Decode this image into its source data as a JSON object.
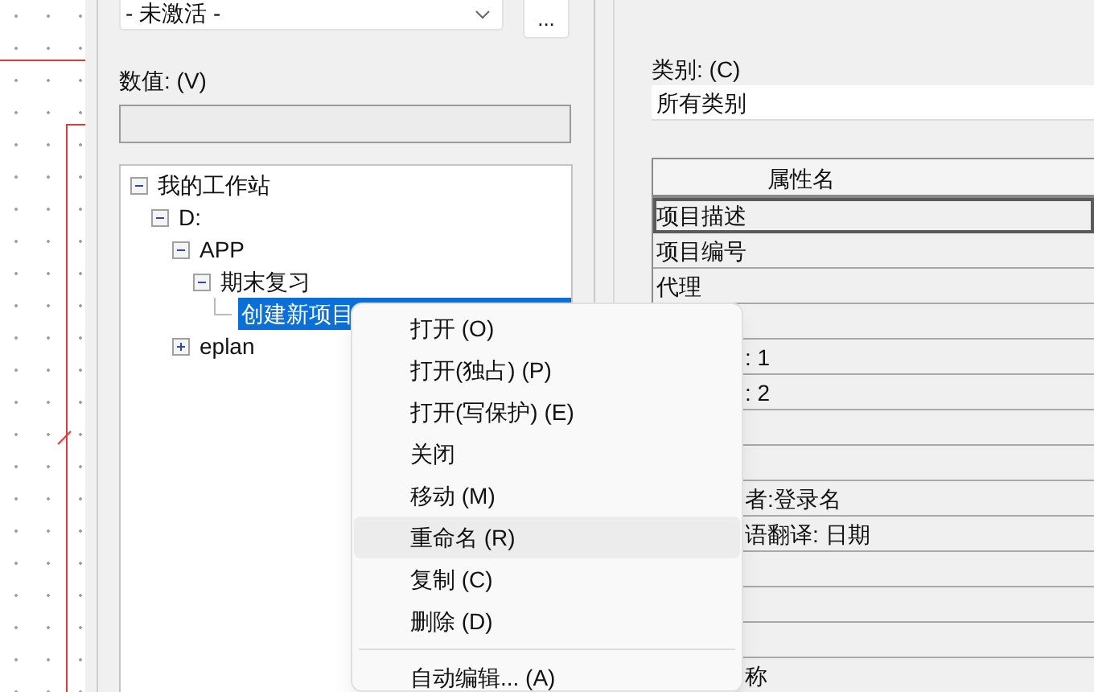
{
  "state_combo": {
    "value": "- 未激活 -"
  },
  "browse_button": {
    "label": "..."
  },
  "value_field": {
    "label": "数值: (V)",
    "disabled": true
  },
  "tree": [
    {
      "label": "我的工作站",
      "expanded": true,
      "selected": false,
      "children": [
        {
          "label": "D:",
          "expanded": true,
          "selected": false,
          "children": [
            {
              "label": "APP",
              "expanded": true,
              "selected": false,
              "children": [
                {
                  "label": "期末复习",
                  "expanded": true,
                  "selected": false,
                  "children": [
                    {
                      "label": "创建新项目",
                      "selected": true
                    }
                  ]
                }
              ]
            },
            {
              "label": "eplan",
              "expanded": false,
              "selected": false
            }
          ]
        }
      ]
    }
  ],
  "category": {
    "label": "类别: (C)",
    "value": "所有类别"
  },
  "property_table": {
    "columns": [
      "属性名"
    ],
    "rows": [
      {
        "text": "项目描述",
        "selected": true,
        "kind": "full"
      },
      {
        "text": "项目编号",
        "selected": false,
        "kind": "full"
      },
      {
        "text": "代理",
        "selected": false,
        "kind": "full"
      },
      {
        "selected": false,
        "kind": "covered"
      },
      {
        "text": ": 1",
        "selected": false,
        "kind": "covered"
      },
      {
        "text": ": 2",
        "selected": false,
        "kind": "covered"
      },
      {
        "selected": false,
        "kind": "covered"
      },
      {
        "selected": false,
        "kind": "covered"
      },
      {
        "text": "者:登录名",
        "selected": false,
        "kind": "covered"
      },
      {
        "text": "语翻译: 日期",
        "selected": false,
        "kind": "covered"
      },
      {
        "selected": false,
        "kind": "covered"
      },
      {
        "selected": false,
        "kind": "covered"
      },
      {
        "selected": false,
        "kind": "covered"
      },
      {
        "text": "称",
        "selected": false,
        "kind": "covered"
      }
    ]
  },
  "context_menu": [
    {
      "label": "打开 (O)",
      "selected": false
    },
    {
      "label": "打开(独占) (P)",
      "selected": false
    },
    {
      "label": "打开(写保护) (E)",
      "selected": false
    },
    {
      "label": "关闭",
      "selected": false
    },
    {
      "label": "移动 (M)",
      "selected": false
    },
    {
      "label": "重命名 (R)",
      "selected": true
    },
    {
      "label": "复制 (C)",
      "selected": false
    },
    {
      "label": "删除 (D)",
      "selected": false,
      "separator_after": true
    },
    {
      "label": "自动编辑... (A)",
      "selected": false
    }
  ]
}
